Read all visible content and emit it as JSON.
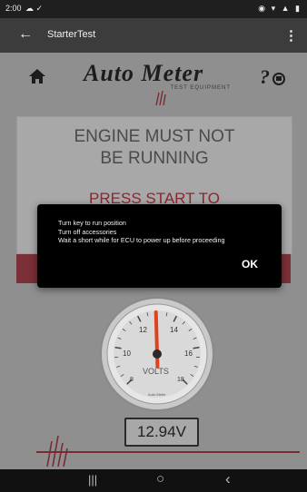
{
  "status": {
    "time": "2:00",
    "left_icons": "☁ ✓",
    "right_icons": "◉ ▾ ▲ ▮"
  },
  "app_bar": {
    "back_icon": "←",
    "title": "StarterTest",
    "menu_icon": "⋮"
  },
  "brand": {
    "name": "Auto Meter",
    "tagline": "TEST EQUIPMENT"
  },
  "panel": {
    "warning_line1": "ENGINE MUST NOT",
    "warning_line2": "BE RUNNING",
    "press_start": "PRESS START TO"
  },
  "gauge": {
    "unit": "VOLTS",
    "ticks": [
      "8",
      "10",
      "12",
      "14",
      "16",
      "18"
    ],
    "maker": "Auto Meter",
    "reading_volts": 12.94
  },
  "readout": {
    "value": "12.94V"
  },
  "dialog": {
    "line1": "Turn key to run position",
    "line2": "Turn off accessories",
    "line3": "Wait a short while for ECU to power up before proceeding",
    "ok_label": "OK"
  },
  "nav": {
    "recents_icon": "|||",
    "home_icon": "○",
    "back_icon": "‹"
  },
  "colors": {
    "accent_red": "#8b2630",
    "dialog_bg": "#000000",
    "app_bar": "#3c3c3c"
  }
}
